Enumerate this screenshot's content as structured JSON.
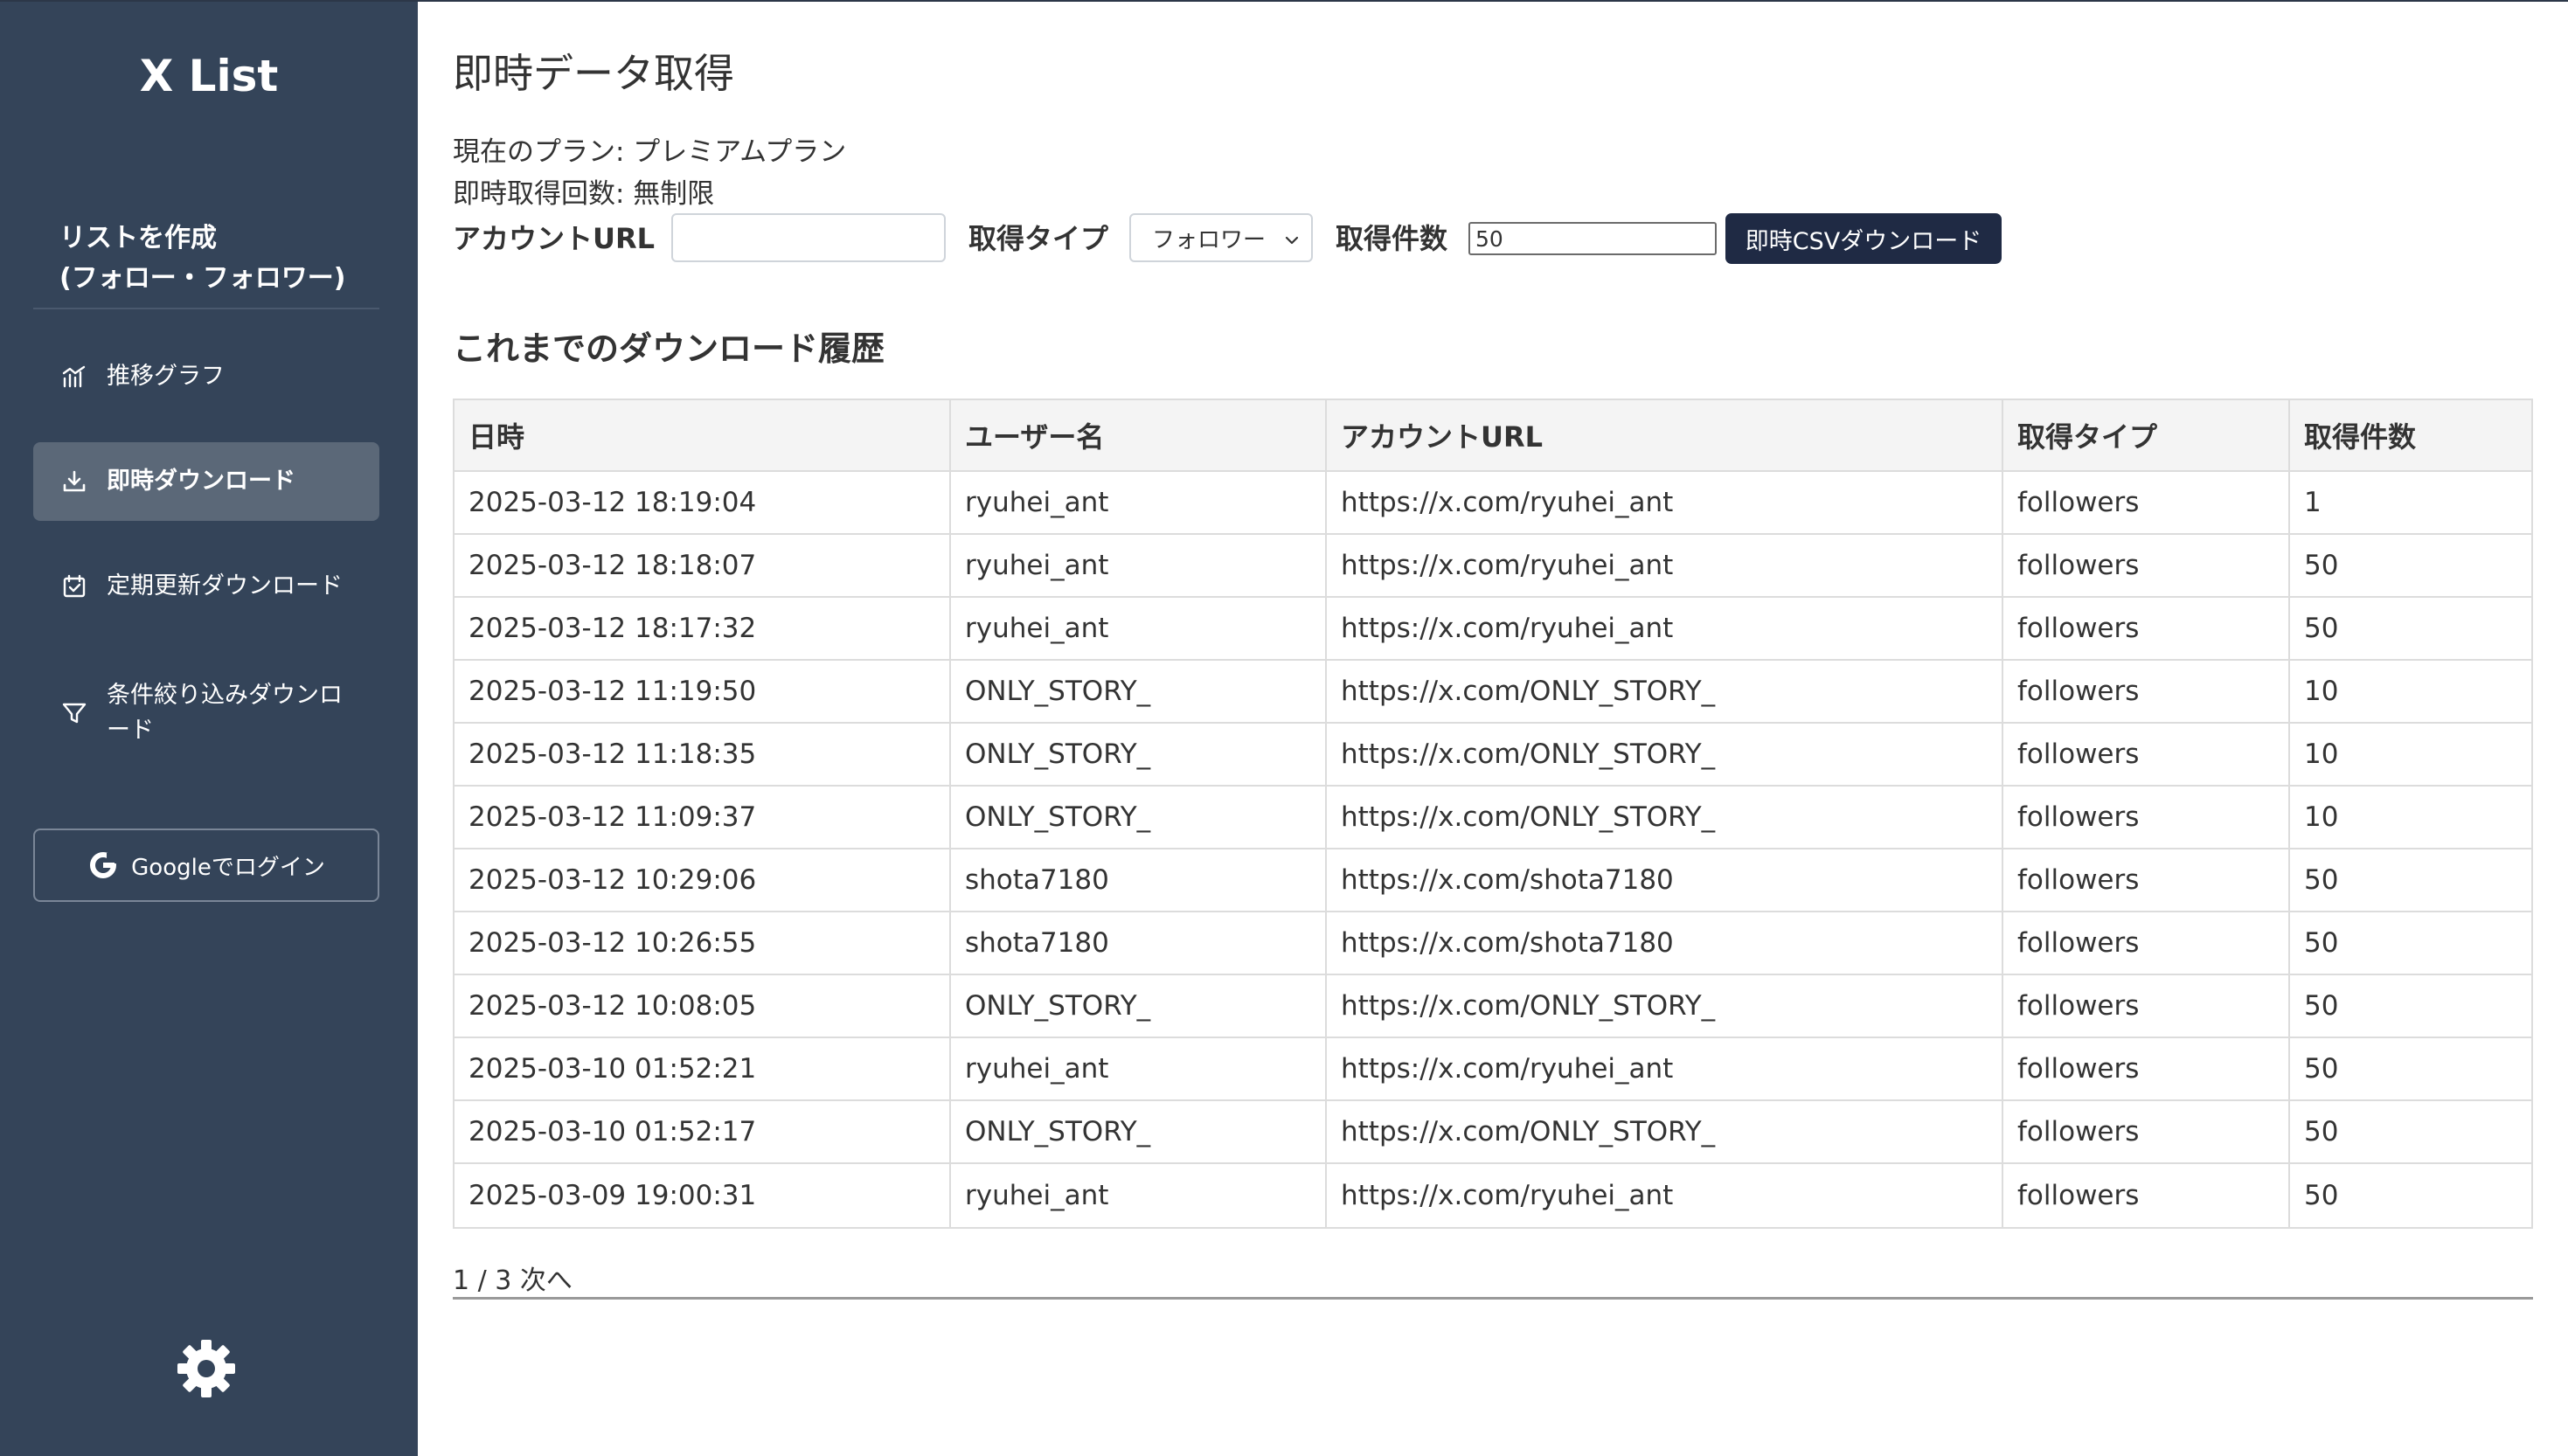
{
  "sidebar": {
    "logo": "X List",
    "create_title_line1": "リストを作成",
    "create_title_line2": "(フォロー・フォロワー)",
    "items": [
      {
        "label": "推移グラフ",
        "icon": "chart-icon"
      },
      {
        "label": "即時ダウンロード",
        "icon": "download-icon",
        "active": true
      },
      {
        "label": "定期更新ダウンロード",
        "icon": "calendar-icon"
      },
      {
        "label": "条件絞り込みダウンロ",
        "label2": "ード",
        "icon": "filter-icon"
      }
    ],
    "login_label": "Googleでログイン",
    "settings_icon": "gear-icon"
  },
  "main": {
    "title": "即時データ取得",
    "plan": "現在のプラン: プレミアムプラン",
    "quota": "即時取得回数: 無制限",
    "form": {
      "account_url_label": "アカウントURL",
      "account_url_value": "",
      "type_label": "取得タイプ",
      "type_value": "フォロワー",
      "count_label": "取得件数",
      "count_value": "50",
      "button_label": "即時CSVダウンロード"
    },
    "history_title": "これまでのダウンロード履歴",
    "table": {
      "headers": [
        "日時",
        "ユーザー名",
        "アカウントURL",
        "取得タイプ",
        "取得件数"
      ],
      "rows": [
        [
          "2025-03-12 18:19:04",
          "ryuhei_ant",
          "https://x.com/ryuhei_ant",
          "followers",
          "1"
        ],
        [
          "2025-03-12 18:18:07",
          "ryuhei_ant",
          "https://x.com/ryuhei_ant",
          "followers",
          "50"
        ],
        [
          "2025-03-12 18:17:32",
          "ryuhei_ant",
          "https://x.com/ryuhei_ant",
          "followers",
          "50"
        ],
        [
          "2025-03-12 11:19:50",
          "ONLY_STORY_",
          "https://x.com/ONLY_STORY_",
          "followers",
          "10"
        ],
        [
          "2025-03-12 11:18:35",
          "ONLY_STORY_",
          "https://x.com/ONLY_STORY_",
          "followers",
          "10"
        ],
        [
          "2025-03-12 11:09:37",
          "ONLY_STORY_",
          "https://x.com/ONLY_STORY_",
          "followers",
          "10"
        ],
        [
          "2025-03-12 10:29:06",
          "shota7180",
          "https://x.com/shota7180",
          "followers",
          "50"
        ],
        [
          "2025-03-12 10:26:55",
          "shota7180",
          "https://x.com/shota7180",
          "followers",
          "50"
        ],
        [
          "2025-03-12 10:08:05",
          "ONLY_STORY_",
          "https://x.com/ONLY_STORY_",
          "followers",
          "50"
        ],
        [
          "2025-03-10 01:52:21",
          "ryuhei_ant",
          "https://x.com/ryuhei_ant",
          "followers",
          "50"
        ],
        [
          "2025-03-10 01:52:17",
          "ONLY_STORY_",
          "https://x.com/ONLY_STORY_",
          "followers",
          "50"
        ],
        [
          "2025-03-09 19:00:31",
          "ryuhei_ant",
          "https://x.com/ryuhei_ant",
          "followers",
          "50"
        ]
      ]
    },
    "pagination": {
      "status": "1 / 3",
      "next_label": "次へ"
    }
  }
}
